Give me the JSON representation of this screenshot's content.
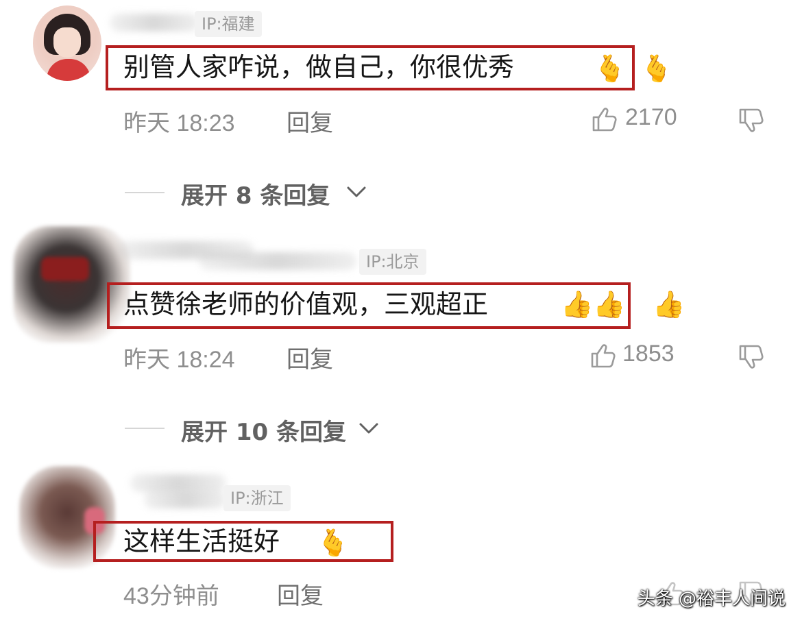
{
  "comments": [
    {
      "ip": "IP:福建",
      "text": "别管人家咋说，做自己，你很优秀",
      "emoji_inline": "🫰",
      "emoji_outside": "🫰",
      "time": "昨天 18:23",
      "reply": "回复",
      "likes": "2170",
      "expand": "展开 8 条回复"
    },
    {
      "ip": "IP:北京",
      "text": "点赞徐老师的价值观，三观超正",
      "emoji_inline": "👍👍",
      "emoji_outside": "👍",
      "time": "昨天 18:24",
      "reply": "回复",
      "likes": "1853",
      "expand": "展开 10 条回复"
    },
    {
      "ip": "IP:浙江",
      "text": "这样生活挺好",
      "emoji_inline": "🫰",
      "time": "43分钟前",
      "reply": "回复"
    }
  ],
  "watermark": "头条 @裕丰人间说",
  "colors": {
    "highlight_box": "#b51f1f",
    "text": "#161616",
    "muted": "#8e8e8e"
  },
  "icons": [
    "like-thumb-icon",
    "dislike-thumb-icon",
    "chevron-down-icon"
  ]
}
